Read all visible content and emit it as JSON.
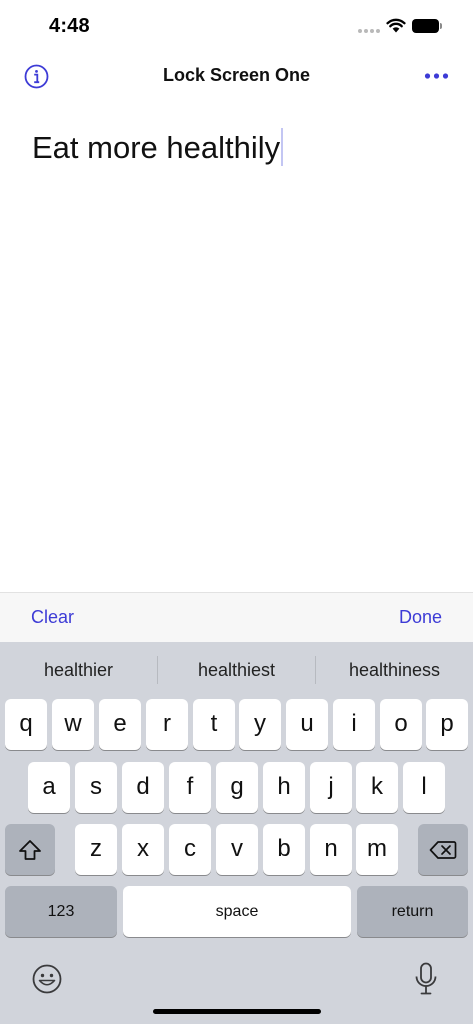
{
  "status_bar": {
    "time": "4:48",
    "icons": [
      "cellular-signal-icon",
      "wifi-icon",
      "battery-icon"
    ]
  },
  "nav": {
    "title": "Lock Screen One",
    "left_icon": "info-icon",
    "right_icon": "more-icon",
    "accent_color": "#3d3bd6"
  },
  "editor": {
    "text": "Eat more healthily"
  },
  "toolbar": {
    "clear_label": "Clear",
    "done_label": "Done"
  },
  "keyboard": {
    "predictions": [
      "healthier",
      "healthiest",
      "healthiness"
    ],
    "row1": [
      "q",
      "w",
      "e",
      "r",
      "t",
      "y",
      "u",
      "i",
      "o",
      "p"
    ],
    "row2": [
      "a",
      "s",
      "d",
      "f",
      "g",
      "h",
      "j",
      "k",
      "l"
    ],
    "row3": [
      "z",
      "x",
      "c",
      "v",
      "b",
      "n",
      "m"
    ],
    "numbers_label": "123",
    "space_label": "space",
    "return_label": "return",
    "icons": [
      "shift-icon",
      "delete-icon",
      "emoji-icon",
      "microphone-icon"
    ]
  }
}
